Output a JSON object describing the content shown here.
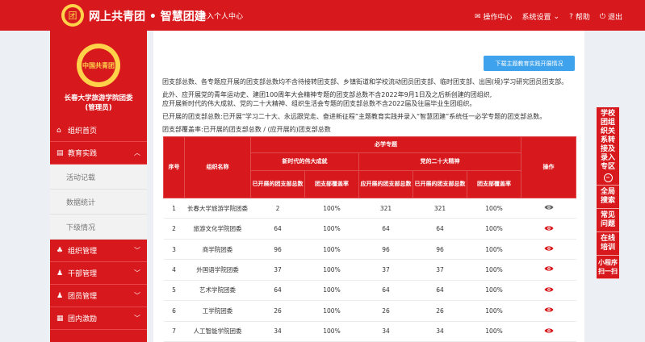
{
  "header": {
    "brand": "网上共青团 • 智慧团建",
    "enter_center": "进入个人中心",
    "nav": {
      "ops_center": "操作中心",
      "settings": "系统设置",
      "help": "帮助",
      "logout": "退出"
    }
  },
  "sidebar": {
    "org_name": "长春大学旅游学院团委",
    "role": "(管理员)",
    "items": [
      {
        "label": "组织首页",
        "icon": "home-icon"
      },
      {
        "label": "教育实践",
        "icon": "book-icon",
        "expanded": true
      },
      {
        "label": "活动记载",
        "sub": true
      },
      {
        "label": "数据统计",
        "sub": true
      },
      {
        "label": "下级情况",
        "sub": true
      },
      {
        "label": "组织管理",
        "icon": "org-icon"
      },
      {
        "label": "干部管理",
        "icon": "cadre-icon"
      },
      {
        "label": "团员管理",
        "icon": "member-icon"
      },
      {
        "label": "团内激励",
        "icon": "award-icon"
      }
    ]
  },
  "main": {
    "download_button": "下载主题教育实践开展情况",
    "paragraphs": [
      "团支部总数、各专题应开展的团支部总数均不含待接转团支部、乡镇街道和学校流动团员团支部、临时团支部、出国(境)学习研究团员团支部。",
      "此外、应开展党的青年运动史、建团100周年大会精神专题的团支部总数不含2022年9月1日及之后新创建的团组织,",
      "应开展新时代的伟大成就、党的二十大精神、组织生活会专题的团支部总数不含2022届及往届毕业生团组织。",
      "已开展的团支部总数:已开展“学习二十大、永远跟党走、奋进新征程”主题教育实践并录入“智慧团建”系统任一必学专题的团支部总数。",
      "团支部覆盖率:已开展的团支部总数 / (应开展的)团支部总数"
    ],
    "table": {
      "headers": {
        "index": "序号",
        "org": "组织名称",
        "required": "必学专题",
        "topic1": "新时代的伟大成就",
        "topic2": "党的二十大精神",
        "done": "已开展的团支部总数",
        "should": "应开展的团支部总数",
        "rate": "团支部覆盖率",
        "action": "操作"
      },
      "rows": [
        {
          "no": "1",
          "name": "长春大学旅游学院团委",
          "a": "2",
          "b": "100%",
          "c": "321",
          "d": "321",
          "e": "100%"
        },
        {
          "no": "2",
          "name": "旅游文化学院团委",
          "a": "64",
          "b": "100%",
          "c": "64",
          "d": "64",
          "e": "100%"
        },
        {
          "no": "3",
          "name": "商学院团委",
          "a": "96",
          "b": "100%",
          "c": "96",
          "d": "96",
          "e": "100%"
        },
        {
          "no": "4",
          "name": "外国语学院团委",
          "a": "37",
          "b": "100%",
          "c": "37",
          "d": "37",
          "e": "100%"
        },
        {
          "no": "5",
          "name": "艺术学院团委",
          "a": "64",
          "b": "100%",
          "c": "64",
          "d": "64",
          "e": "100%"
        },
        {
          "no": "6",
          "name": "工学院团委",
          "a": "26",
          "b": "100%",
          "c": "26",
          "d": "26",
          "e": "100%"
        },
        {
          "no": "7",
          "name": "人工智能学院团委",
          "a": "34",
          "b": "100%",
          "c": "34",
          "d": "34",
          "e": "100%"
        }
      ]
    }
  },
  "right_panel": {
    "items": [
      "学校团组织关系转接及录入专区",
      "全局搜索",
      "常见问题",
      "在线培训",
      "小程序扫一扫"
    ]
  },
  "colors": {
    "brand_red": "#d7191d",
    "button_blue": "#3fa2ec"
  }
}
